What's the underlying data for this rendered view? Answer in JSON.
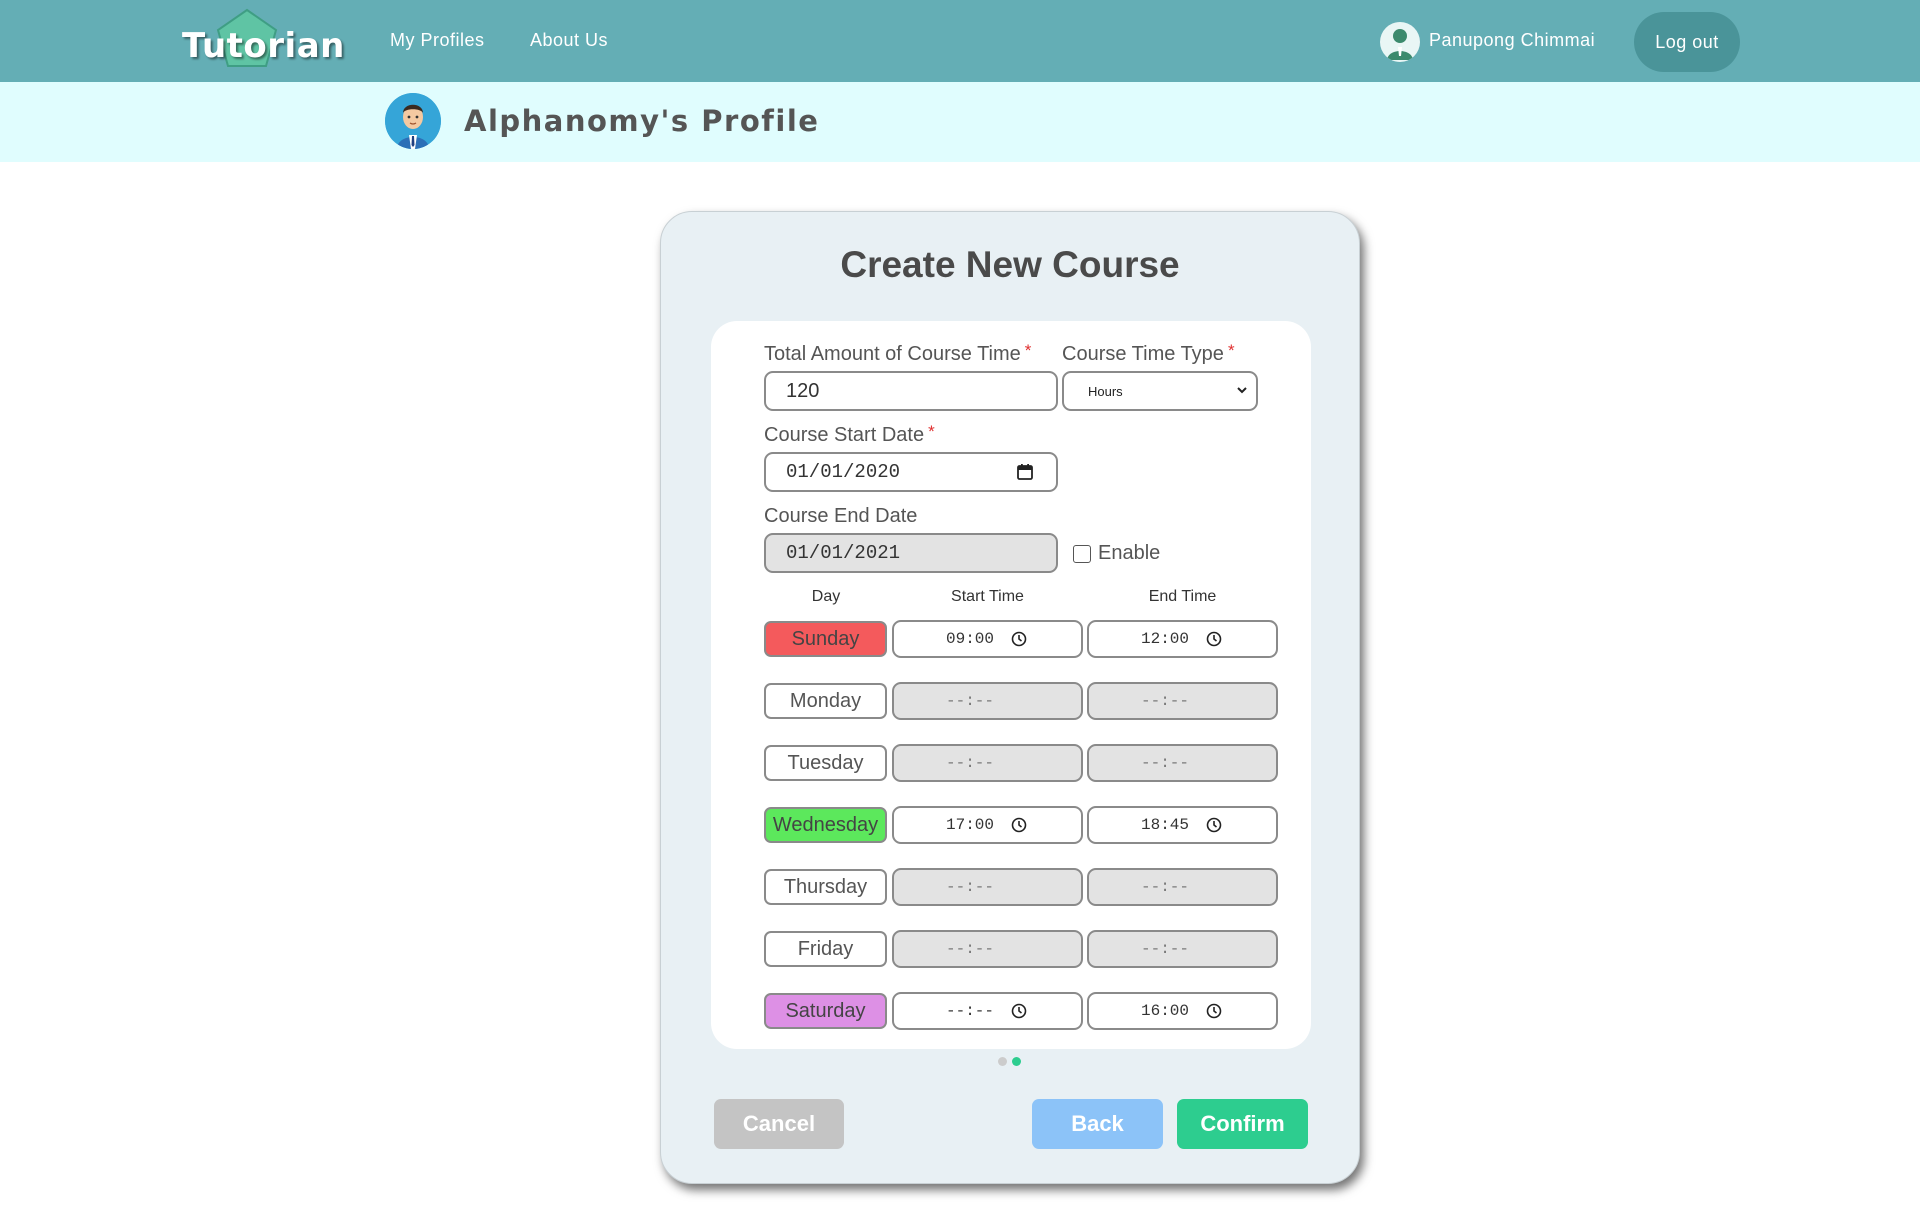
{
  "navbar": {
    "logo_text": "Tutorian",
    "links": [
      "My Profiles",
      "About Us"
    ],
    "user_name": "Panupong Chimmai",
    "logout_label": "Log out"
  },
  "profile": {
    "title": "Alphanomy's Profile"
  },
  "modal": {
    "title": "Create New Course",
    "total_time_label": "Total Amount of Course Time",
    "total_time_value": "120",
    "time_type_label": "Course Time Type",
    "time_type_value": "Hours",
    "start_date_label": "Course Start Date",
    "start_date_value": "01/01/2020",
    "end_date_label": "Course End Date",
    "end_date_value": "01/01/2021",
    "enable_label": "Enable",
    "required_mark": "*",
    "columns": {
      "day": "Day",
      "start": "Start Time",
      "end": "End Time"
    },
    "schedule": [
      {
        "day": "Sunday",
        "start": "09:00",
        "end": "12:00"
      },
      {
        "day": "Monday",
        "start": "--:--",
        "end": "--:--"
      },
      {
        "day": "Tuesday",
        "start": "--:--",
        "end": "--:--"
      },
      {
        "day": "Wednesday",
        "start": "17:00",
        "end": "18:45"
      },
      {
        "day": "Thursday",
        "start": "--:--",
        "end": "--:--"
      },
      {
        "day": "Friday",
        "start": "--:--",
        "end": "--:--"
      },
      {
        "day": "Saturday",
        "start": "--:--",
        "end": "16:00"
      }
    ],
    "pagination": {
      "current": 2,
      "total": 2
    },
    "buttons": {
      "cancel": "Cancel",
      "back": "Back",
      "confirm": "Confirm"
    }
  },
  "colors": {
    "navbar": "#64aeb5",
    "profile_bar": "#e0fdfe",
    "sunday": "#f45a5c",
    "wednesday": "#5ce85c",
    "saturday": "#dd90e5",
    "confirm": "#2dcd8f",
    "back": "#8cc3f8",
    "cancel": "#c4c4c4"
  }
}
